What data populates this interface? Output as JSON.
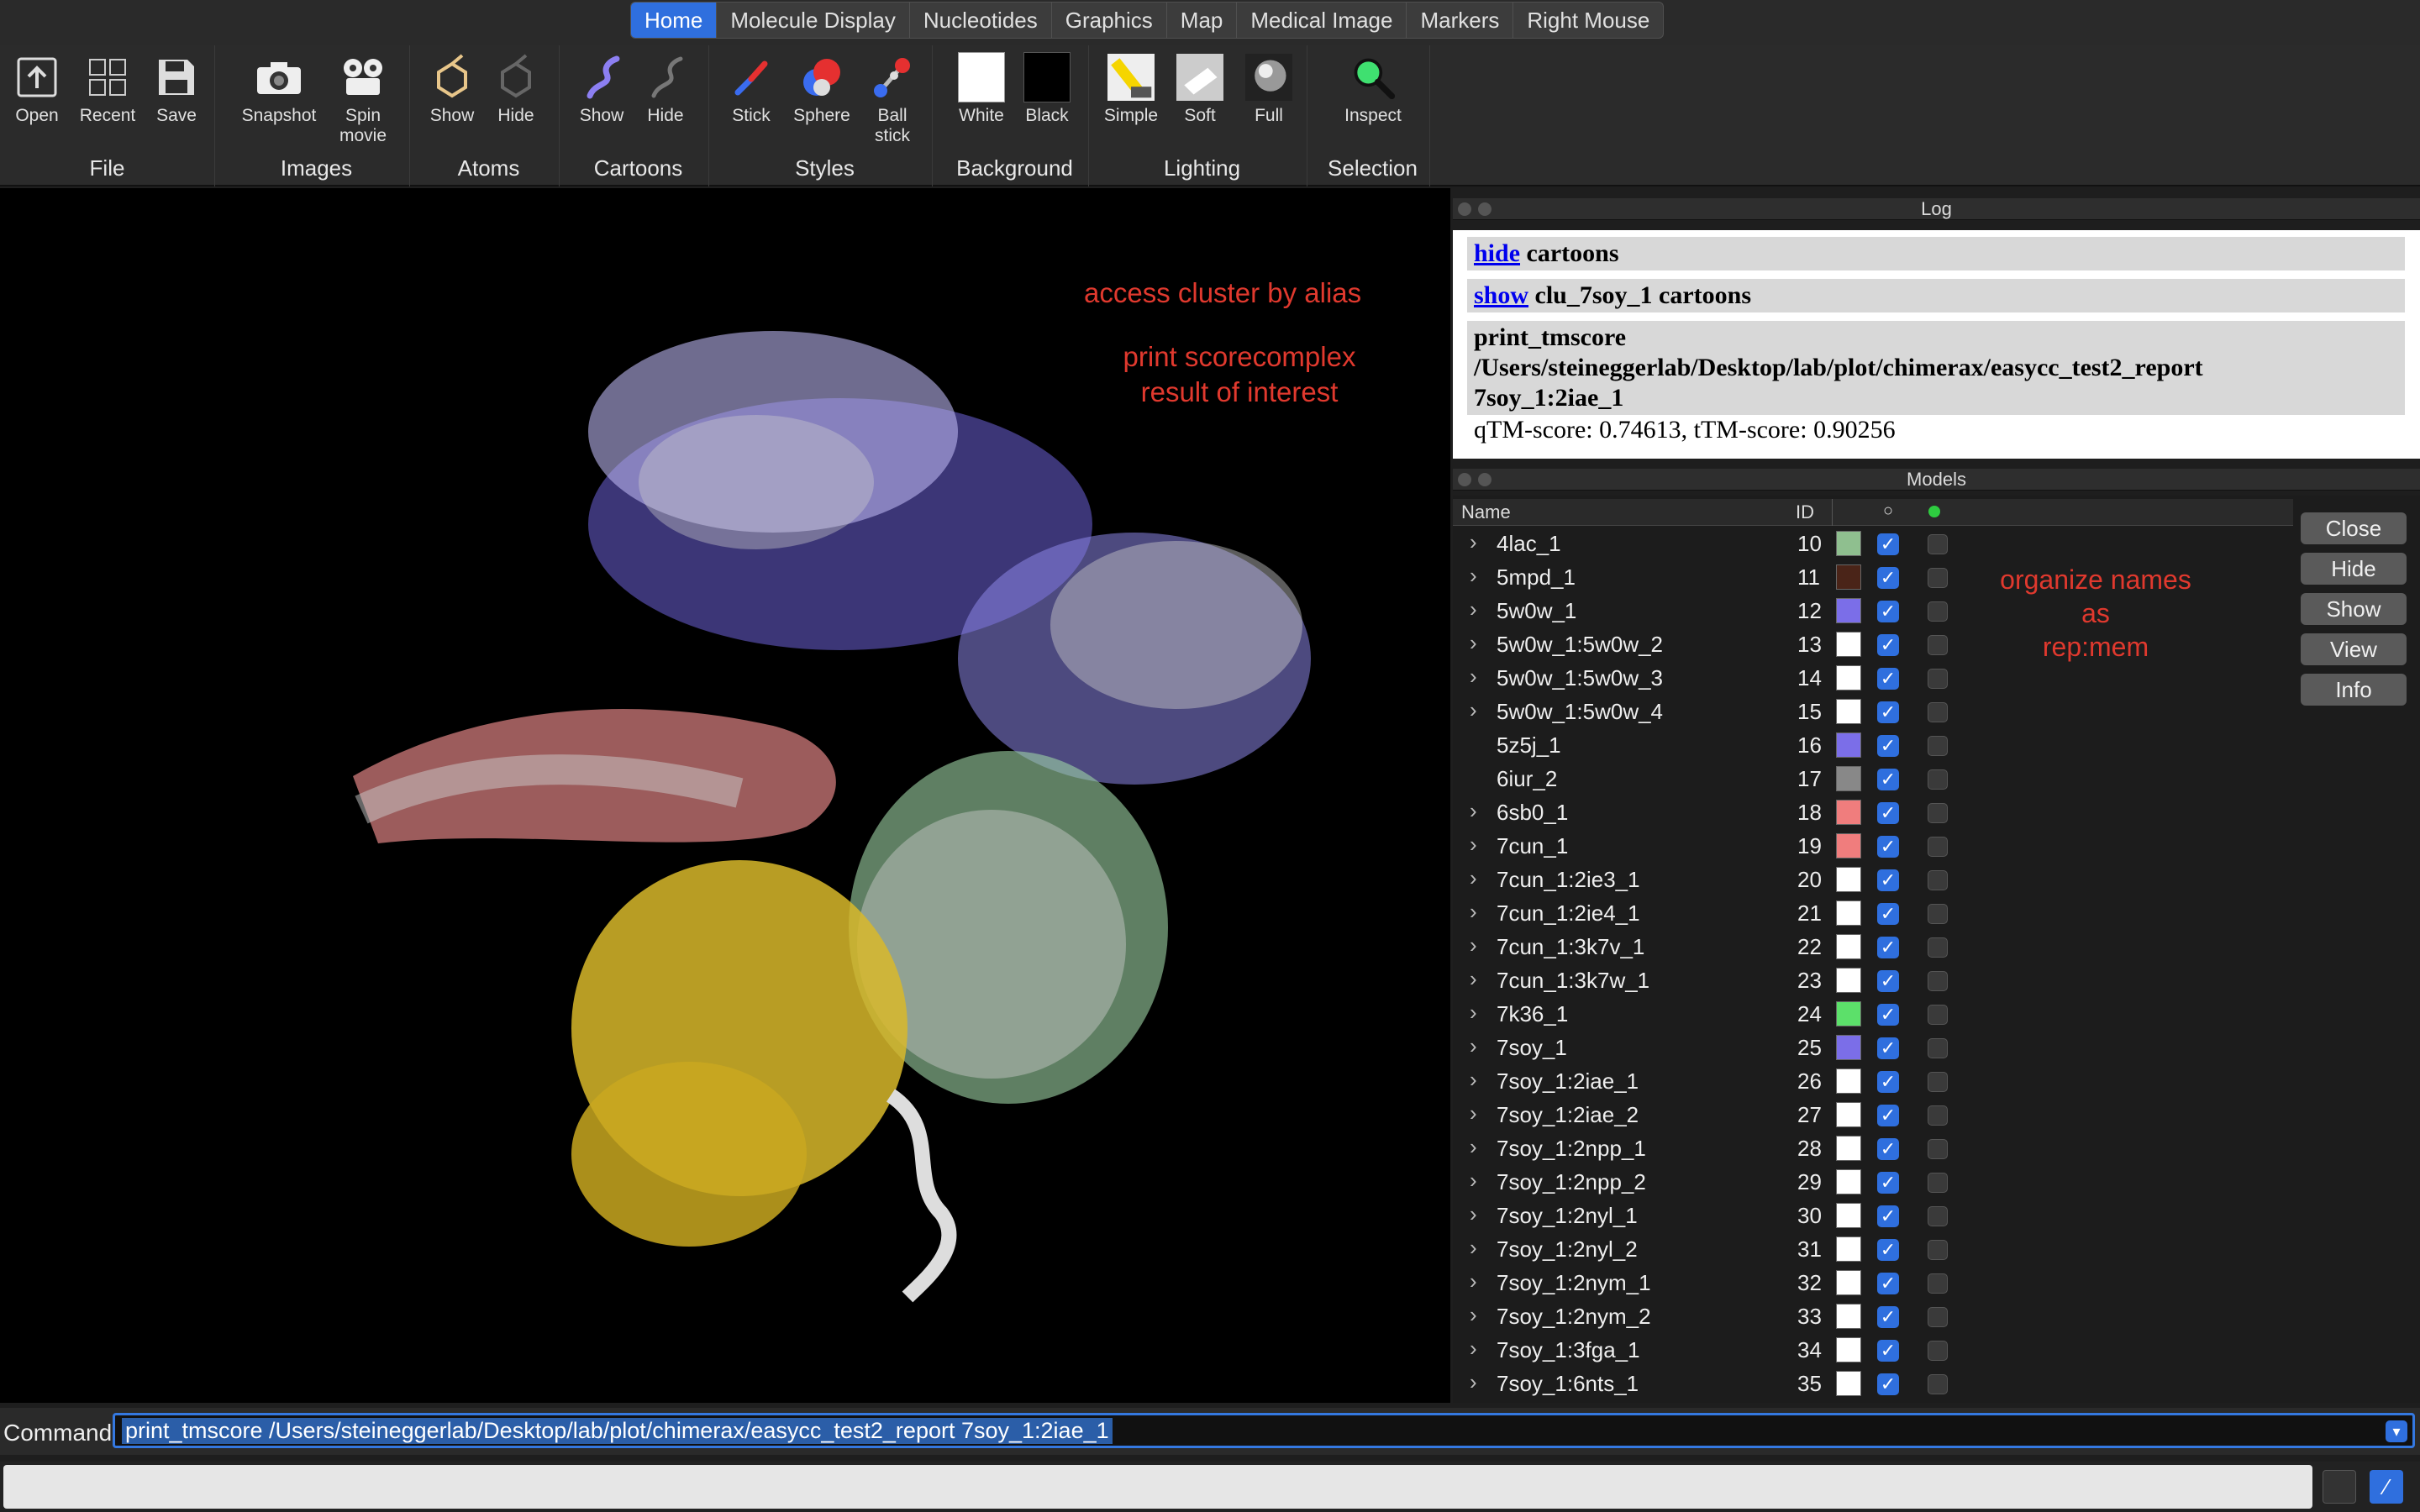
{
  "tabs": [
    "Home",
    "Molecule Display",
    "Nucleotides",
    "Graphics",
    "Map",
    "Medical Image",
    "Markers",
    "Right Mouse"
  ],
  "ribbon": {
    "file": {
      "title": "File",
      "open": "Open",
      "recent": "Recent",
      "save": "Save"
    },
    "images": {
      "title": "Images",
      "snapshot": "Snapshot",
      "spin": "Spin movie"
    },
    "atoms": {
      "title": "Atoms",
      "show": "Show",
      "hide": "Hide"
    },
    "cartoons": {
      "title": "Cartoons",
      "show": "Show",
      "hide": "Hide"
    },
    "styles": {
      "title": "Styles",
      "stick": "Stick",
      "sphere": "Sphere",
      "ball": "Ball stick"
    },
    "background": {
      "title": "Background",
      "white": "White",
      "black": "Black"
    },
    "lighting": {
      "title": "Lighting",
      "simple": "Simple",
      "soft": "Soft",
      "full": "Full"
    },
    "selection": {
      "title": "Selection",
      "inspect": "Inspect"
    }
  },
  "annotations": {
    "alias": "access cluster by alias",
    "print1": "print scorecomplex",
    "print2": "result of interest",
    "organize1": "organize names",
    "organize2": "as",
    "organize3": "rep:mem"
  },
  "log": {
    "title": "Log",
    "r1_link": "hide",
    "r1_text": " cartoons",
    "r2_link": "show",
    "r2_text": " clu_7soy_1 cartoons",
    "r3_l1": "print_tmscore",
    "r3_l2": "/Users/steineggerlab/Desktop/lab/plot/chimerax/easycc_test2_report",
    "r3_l3": "7soy_1:2iae_1",
    "r3_result": "qTM-score: 0.74613, tTM-score: 0.90256"
  },
  "models": {
    "title": "Models",
    "col_name": "Name",
    "col_id": "ID",
    "buttons": [
      "Close",
      "Hide",
      "Show",
      "View",
      "Info"
    ],
    "rows": [
      {
        "name": "4lac_1",
        "id": "10",
        "color": "#8fbf8f",
        "expand": true
      },
      {
        "name": "5mpd_1",
        "id": "11",
        "color": "#4a2418",
        "expand": true
      },
      {
        "name": "5w0w_1",
        "id": "12",
        "color": "#7b6ee8",
        "expand": true
      },
      {
        "name": "5w0w_1:5w0w_2",
        "id": "13",
        "color": "#ffffff",
        "expand": true
      },
      {
        "name": "5w0w_1:5w0w_3",
        "id": "14",
        "color": "#ffffff",
        "expand": true
      },
      {
        "name": "5w0w_1:5w0w_4",
        "id": "15",
        "color": "#ffffff",
        "expand": true
      },
      {
        "name": "5z5j_1",
        "id": "16",
        "color": "#7b6ee8",
        "expand": false
      },
      {
        "name": "6iur_2",
        "id": "17",
        "color": "#888888",
        "expand": false
      },
      {
        "name": "6sb0_1",
        "id": "18",
        "color": "#f07d7d",
        "expand": true
      },
      {
        "name": "7cun_1",
        "id": "19",
        "color": "#f07d7d",
        "expand": true
      },
      {
        "name": "7cun_1:2ie3_1",
        "id": "20",
        "color": "#ffffff",
        "expand": true
      },
      {
        "name": "7cun_1:2ie4_1",
        "id": "21",
        "color": "#ffffff",
        "expand": true
      },
      {
        "name": "7cun_1:3k7v_1",
        "id": "22",
        "color": "#ffffff",
        "expand": true
      },
      {
        "name": "7cun_1:3k7w_1",
        "id": "23",
        "color": "#ffffff",
        "expand": true
      },
      {
        "name": "7k36_1",
        "id": "24",
        "color": "#5ce06a",
        "expand": true
      },
      {
        "name": "7soy_1",
        "id": "25",
        "color": "#7b6ee8",
        "expand": true
      },
      {
        "name": "7soy_1:2iae_1",
        "id": "26",
        "color": "#ffffff",
        "expand": true
      },
      {
        "name": "7soy_1:2iae_2",
        "id": "27",
        "color": "#ffffff",
        "expand": true
      },
      {
        "name": "7soy_1:2npp_1",
        "id": "28",
        "color": "#ffffff",
        "expand": true
      },
      {
        "name": "7soy_1:2npp_2",
        "id": "29",
        "color": "#ffffff",
        "expand": true
      },
      {
        "name": "7soy_1:2nyl_1",
        "id": "30",
        "color": "#ffffff",
        "expand": true
      },
      {
        "name": "7soy_1:2nyl_2",
        "id": "31",
        "color": "#ffffff",
        "expand": true
      },
      {
        "name": "7soy_1:2nym_1",
        "id": "32",
        "color": "#ffffff",
        "expand": true
      },
      {
        "name": "7soy_1:2nym_2",
        "id": "33",
        "color": "#ffffff",
        "expand": true
      },
      {
        "name": "7soy_1:3fga_1",
        "id": "34",
        "color": "#ffffff",
        "expand": true
      },
      {
        "name": "7soy_1:6nts_1",
        "id": "35",
        "color": "#ffffff",
        "expand": true
      }
    ]
  },
  "command": {
    "label": "Command:",
    "value": "print_tmscore /Users/steineggerlab/Desktop/lab/plot/chimerax/easycc_test2_report  7soy_1:2iae_1"
  },
  "colors": {
    "accent": "#2f6fde",
    "annotation": "#e0392e"
  }
}
